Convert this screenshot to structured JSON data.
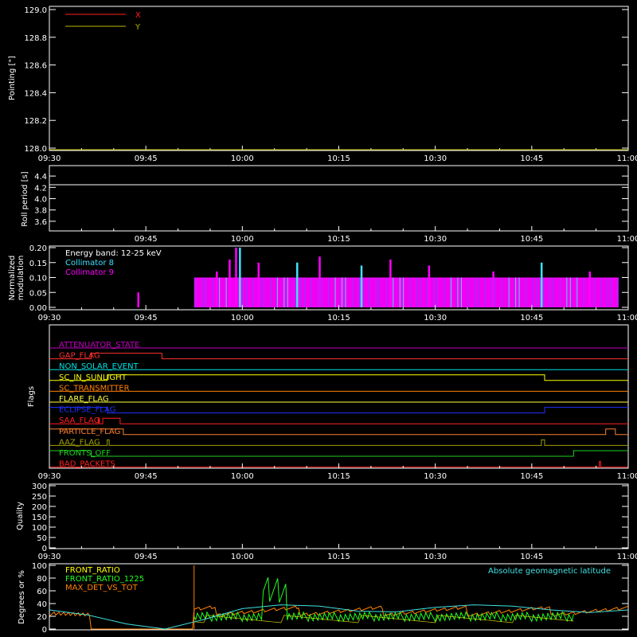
{
  "colors": {
    "background": "#000000",
    "axes": "#ffffff",
    "x_series": "#ff2020",
    "y_series": "#b8b800",
    "coll8": "#40e0ff",
    "coll9": "#ff00ff",
    "front_ratio": "#ffff00",
    "front_ratio_1225": "#20ff20",
    "max_det": "#ff8000",
    "geomag": "#40e0e0"
  },
  "chart_data": [
    {
      "id": "pointing",
      "type": "line",
      "ylabel": "Pointing [\"]",
      "ylim": [
        128.0,
        129.0
      ],
      "yticks": [
        "128.0",
        "128.2",
        "128.4",
        "128.6",
        "128.8",
        "129.0"
      ],
      "xticks": [
        "09:30",
        "09:45",
        "10:00",
        "10:15",
        "10:30",
        "10:45",
        "11:00"
      ],
      "legend": [
        "X",
        "Y"
      ],
      "legend_position": "top-left",
      "series": [
        {
          "name": "X",
          "values": []
        },
        {
          "name": "Y",
          "values": []
        }
      ]
    },
    {
      "id": "roll",
      "type": "line",
      "ylabel": "Roll period [s]",
      "ylim": [
        3.5,
        4.5
      ],
      "yticks": [
        "3.6",
        "3.8",
        "4.0",
        "4.2",
        "4.4"
      ],
      "xticks": [
        "09:45",
        "10:00",
        "10:15",
        "10:30",
        "10:45",
        "11:00"
      ],
      "series": [
        {
          "x_min": [
            0,
            90
          ],
          "values": [
            4.2,
            4.2
          ]
        }
      ]
    },
    {
      "id": "modulation",
      "type": "bar",
      "ylabel_lines": [
        "Normalized",
        "modulation"
      ],
      "ylim": [
        0.0,
        0.2
      ],
      "yticks": [
        "0.00",
        "0.05",
        "0.10",
        "0.15",
        "0.20"
      ],
      "xticks": [
        "09:30",
        "09:45",
        "10:00",
        "10:15",
        "10:30",
        "10:45",
        "11:00"
      ],
      "legend": [
        "Energy band: 12-25 keV",
        "Collimator 8",
        "Collimator 9"
      ],
      "legend_position": "top-left",
      "active_range_min": [
        22.5,
        88.5
      ],
      "baseline": 0.1,
      "spikes": [
        {
          "x": 13.8,
          "v": 0.05,
          "c": "coll9"
        },
        {
          "x": 26.0,
          "v": 0.12,
          "c": "coll9"
        },
        {
          "x": 28.0,
          "v": 0.16,
          "c": "coll9"
        },
        {
          "x": 29.0,
          "v": 0.2,
          "c": "coll9"
        },
        {
          "x": 29.6,
          "v": 0.2,
          "c": "coll8"
        },
        {
          "x": 32.5,
          "v": 0.15,
          "c": "coll9"
        },
        {
          "x": 38.5,
          "v": 0.15,
          "c": "coll8"
        },
        {
          "x": 42.0,
          "v": 0.17,
          "c": "coll9"
        },
        {
          "x": 48.5,
          "v": 0.14,
          "c": "coll8"
        },
        {
          "x": 53.0,
          "v": 0.16,
          "c": "coll9"
        },
        {
          "x": 59.0,
          "v": 0.14,
          "c": "coll9"
        },
        {
          "x": 69.0,
          "v": 0.12,
          "c": "coll9"
        },
        {
          "x": 76.5,
          "v": 0.15,
          "c": "coll8"
        },
        {
          "x": 84.0,
          "v": 0.12,
          "c": "coll9"
        }
      ]
    },
    {
      "id": "flags",
      "type": "step",
      "ylabel": "Flags",
      "xticks": [
        "09:30",
        "09:45",
        "10:00",
        "10:15",
        "10:30",
        "10:45",
        "11:00"
      ],
      "series": [
        {
          "name": "ATTENUATOR_STATE",
          "color": "#c000c0",
          "steps": [
            [
              0,
              0
            ],
            [
              90,
              0
            ]
          ]
        },
        {
          "name": "GAP_FLAG",
          "color": "#ff3030",
          "steps": [
            [
              0,
              0
            ],
            [
              6.5,
              1
            ],
            [
              17.5,
              0
            ],
            [
              90,
              0
            ]
          ]
        },
        {
          "name": "NON_SOLAR_EVENT",
          "color": "#00e0e0",
          "steps": [
            [
              0,
              0
            ],
            [
              90,
              0
            ]
          ]
        },
        {
          "name": "SC_IN_SUNLIGHT",
          "color": "#ffff00",
          "steps": [
            [
              0,
              0
            ],
            [
              9.0,
              1
            ],
            [
              77.0,
              0
            ],
            [
              90,
              0
            ]
          ]
        },
        {
          "name": "SC_TRANSMITTER",
          "color": "#ff8000",
          "steps": [
            [
              0,
              0
            ],
            [
              90,
              0
            ]
          ]
        },
        {
          "name": "FLARE_FLAG",
          "color": "#ffff40",
          "steps": [
            [
              0,
              0
            ],
            [
              90,
              0
            ]
          ]
        },
        {
          "name": "ECLIPSE_FLAG",
          "color": "#2030ff",
          "steps": [
            [
              0,
              1
            ],
            [
              9.0,
              0
            ],
            [
              77.0,
              1
            ],
            [
              90,
              1
            ]
          ]
        },
        {
          "name": "SAA_FLAG",
          "color": "#ff2020",
          "steps": [
            [
              0,
              0
            ],
            [
              7.6,
              1
            ],
            [
              7.8,
              0
            ],
            [
              8.3,
              1
            ],
            [
              11.0,
              0
            ],
            [
              90,
              0
            ]
          ]
        },
        {
          "name": "PARTICLE_FLAG",
          "color": "#ff8030",
          "steps": [
            [
              0,
              1
            ],
            [
              11.5,
              0
            ],
            [
              86.5,
              1
            ],
            [
              88.0,
              0
            ],
            [
              90,
              0
            ]
          ]
        },
        {
          "name": "AAZ_FLAG",
          "color": "#a0a000",
          "steps": [
            [
              0,
              0
            ],
            [
              9.0,
              1
            ],
            [
              9.3,
              0
            ],
            [
              76.5,
              1
            ],
            [
              77.0,
              0
            ],
            [
              90,
              0
            ]
          ]
        },
        {
          "name": "FRONTS_OFF",
          "color": "#20d020",
          "steps": [
            [
              0,
              1
            ],
            [
              6.5,
              0
            ],
            [
              81.5,
              1
            ],
            [
              90,
              1
            ]
          ]
        },
        {
          "name": "BAD_PACKETS",
          "color": "#ff2020",
          "steps": [
            [
              0,
              0
            ],
            [
              85.5,
              1
            ],
            [
              85.7,
              0
            ],
            [
              90,
              0
            ]
          ]
        }
      ]
    },
    {
      "id": "quality",
      "type": "line",
      "ylabel": "Quality",
      "ylim": [
        0,
        300
      ],
      "yticks": [
        "0",
        "50",
        "100",
        "150",
        "200",
        "250",
        "300"
      ],
      "xticks": [
        "09:30",
        "09:45",
        "10:00",
        "10:15",
        "10:30",
        "10:45",
        "11:00"
      ],
      "series": []
    },
    {
      "id": "ratios",
      "type": "line",
      "ylabel": "Degrees or %",
      "ylim": [
        0,
        100
      ],
      "yticks": [
        "0",
        "20",
        "40",
        "60",
        "80",
        "100"
      ],
      "legend": [
        "FRONT_RATIO",
        "FRONT_RATIO_1225",
        "MAX_DET_VS_TOT"
      ],
      "legend_right": "Absolute geomagnetic latitude",
      "series": [
        {
          "name": "Absolute geomagnetic latitude",
          "x_min": [
            0,
            6,
            12,
            18,
            24,
            30,
            36,
            42,
            48,
            54,
            60,
            66,
            72,
            78,
            84,
            90
          ],
          "values": [
            30,
            22,
            8,
            0,
            15,
            32,
            38,
            36,
            28,
            27,
            34,
            38,
            36,
            30,
            26,
            30
          ]
        },
        {
          "name": "MAX_DET_VS_TOT",
          "x_min": [
            0,
            6.5,
            6.5,
            22.5,
            22.5,
            30,
            40,
            50,
            60,
            70,
            80,
            90
          ],
          "values": [
            25,
            22,
            0,
            0,
            28,
            30,
            32,
            28,
            30,
            26,
            29,
            27
          ]
        },
        {
          "name": "FRONT_RATIO_1225",
          "x_min": [
            22.5,
            28,
            32,
            35,
            38,
            45,
            55,
            65,
            75,
            81.5
          ],
          "values": [
            15,
            20,
            50,
            85,
            25,
            18,
            20,
            17,
            15,
            0
          ]
        }
      ]
    }
  ]
}
